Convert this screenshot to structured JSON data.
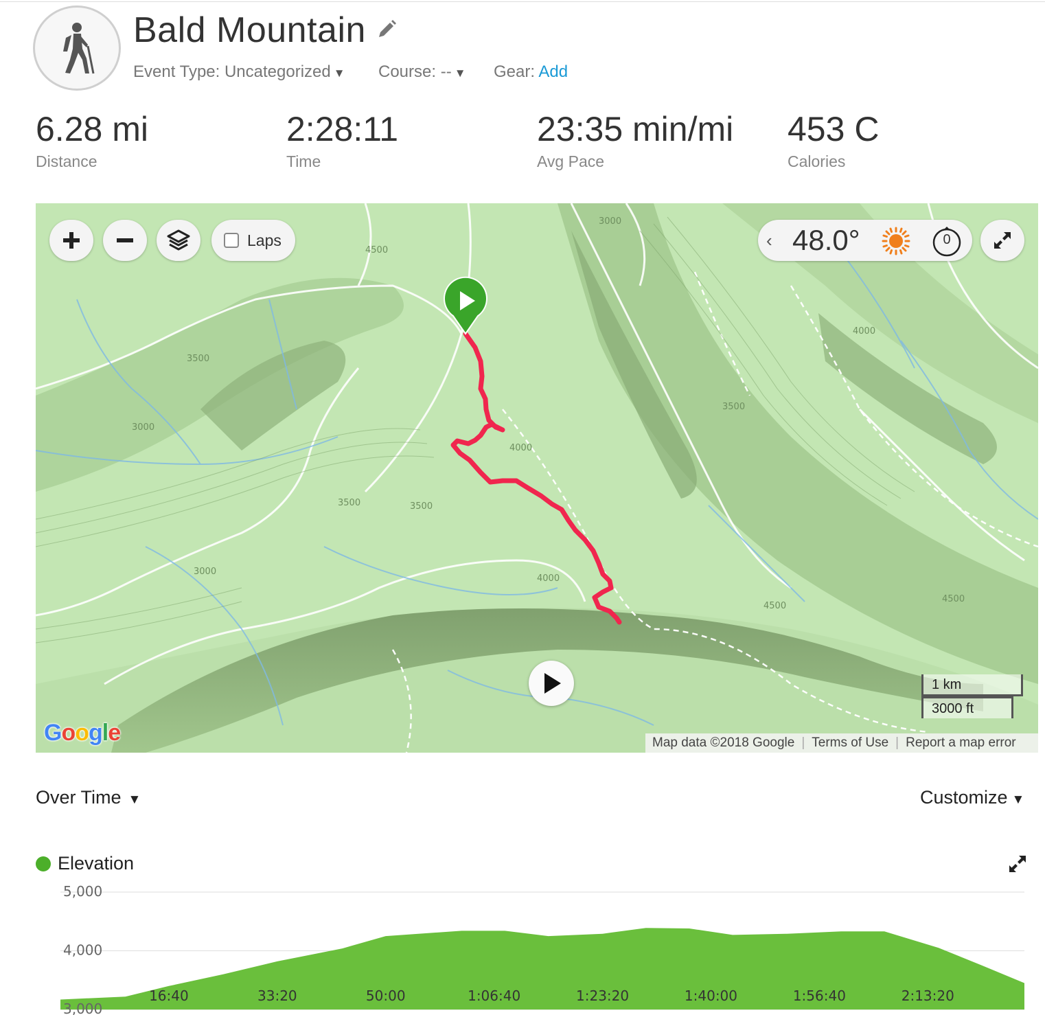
{
  "activity": {
    "title": "Bald Mountain",
    "activity_icon": "hiker-icon",
    "event_type_label": "Event Type: Uncategorized",
    "course_label": "Course: --",
    "gear_label": "Gear:",
    "gear_link": "Add"
  },
  "stats": [
    {
      "value": "6.28 mi",
      "label": "Distance"
    },
    {
      "value": "2:28:11",
      "label": "Time"
    },
    {
      "value": "23:35 min/mi",
      "label": "Avg Pace"
    },
    {
      "value": "453 C",
      "label": "Calories"
    }
  ],
  "map": {
    "laps_label": "Laps",
    "laps_checked": false,
    "temperature": "48.0°",
    "weather_icon": "sun-icon",
    "timer_value": "0",
    "scale_km": "1 km",
    "scale_ft": "3000 ft",
    "attribution": "Map data ©2018 Google",
    "terms": "Terms of Use",
    "report": "Report a map error",
    "logo": "Google",
    "contour_labels": [
      "4500",
      "3000",
      "3500",
      "4000"
    ],
    "route_color": "#f0264e",
    "terrain_color": "#bfe5b0"
  },
  "chart_controls": {
    "view_label": "Over Time",
    "customize_label": "Customize"
  },
  "chart_data": {
    "type": "area",
    "series": [
      {
        "name": "Elevation",
        "color": "#6abf3c"
      }
    ],
    "xlabel": "",
    "ylabel": "",
    "ylim": [
      3000,
      5000
    ],
    "y_ticks": [
      "5,000",
      "4,000",
      "3,000"
    ],
    "x_ticks": [
      "16:40",
      "33:20",
      "50:00",
      "1:06:40",
      "1:23:20",
      "1:40:00",
      "1:56:40",
      "2:13:20"
    ],
    "x_seconds": [
      0,
      600,
      1000,
      1500,
      2000,
      2600,
      3000,
      3700,
      4100,
      4500,
      5000,
      5400,
      5800,
      6200,
      6700,
      7200,
      7600,
      8100,
      8500,
      8891
    ],
    "y_values": [
      3170,
      3220,
      3400,
      3600,
      3820,
      4040,
      4250,
      4340,
      4340,
      4250,
      4290,
      4390,
      4380,
      4270,
      4290,
      4330,
      4330,
      4050,
      3750,
      3450
    ]
  }
}
